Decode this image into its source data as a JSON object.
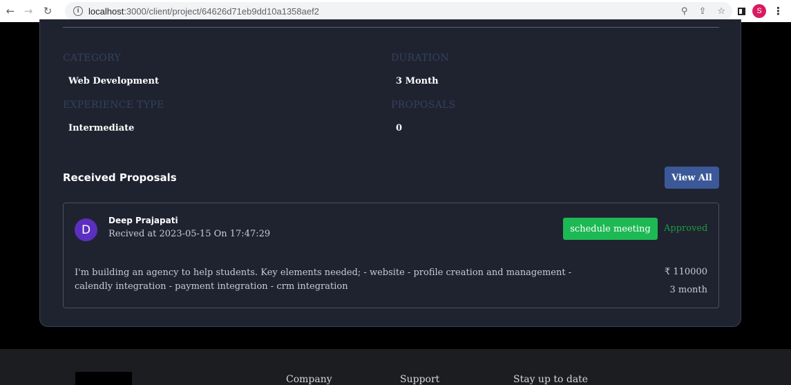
{
  "browser": {
    "url_host": "localhost",
    "url_path": ":3000/client/project/64626d71eb9dd10a1358aef2",
    "profile_initial": "S"
  },
  "project": {
    "category_label": "CATEGORY",
    "category_value": "Web Development",
    "duration_label": "DURATION",
    "duration_value": "3 Month",
    "experience_label": "EXPERIENCE TYPE",
    "experience_value": "Intermediate",
    "proposals_label": "PROPOSALS",
    "proposals_value": "0"
  },
  "received": {
    "title": "Received Proposals",
    "view_all_label": "View All"
  },
  "proposal": {
    "avatar_initial": "D",
    "name": "Deep Prajapati",
    "received_at": "Recived at 2023-05-15 On 17:47:29",
    "schedule_label": "schedule meeting",
    "status": "Approved",
    "description": "I'm building an agency to help students. Key elements needed; - website - profile creation and management - calendly integration - payment integration - crm integration",
    "price": "₹ 110000",
    "duration": "3 month"
  },
  "footer": {
    "col_company": "Company",
    "col_support": "Support",
    "col_stay": "Stay up to date"
  },
  "colors": {
    "card_bg": "#1f2330",
    "label": "#33415e",
    "view_all_bg": "#3b5998",
    "schedule_bg": "#1db954",
    "approved": "#1e9b3c",
    "avatar_bg": "#5b2fc0"
  }
}
